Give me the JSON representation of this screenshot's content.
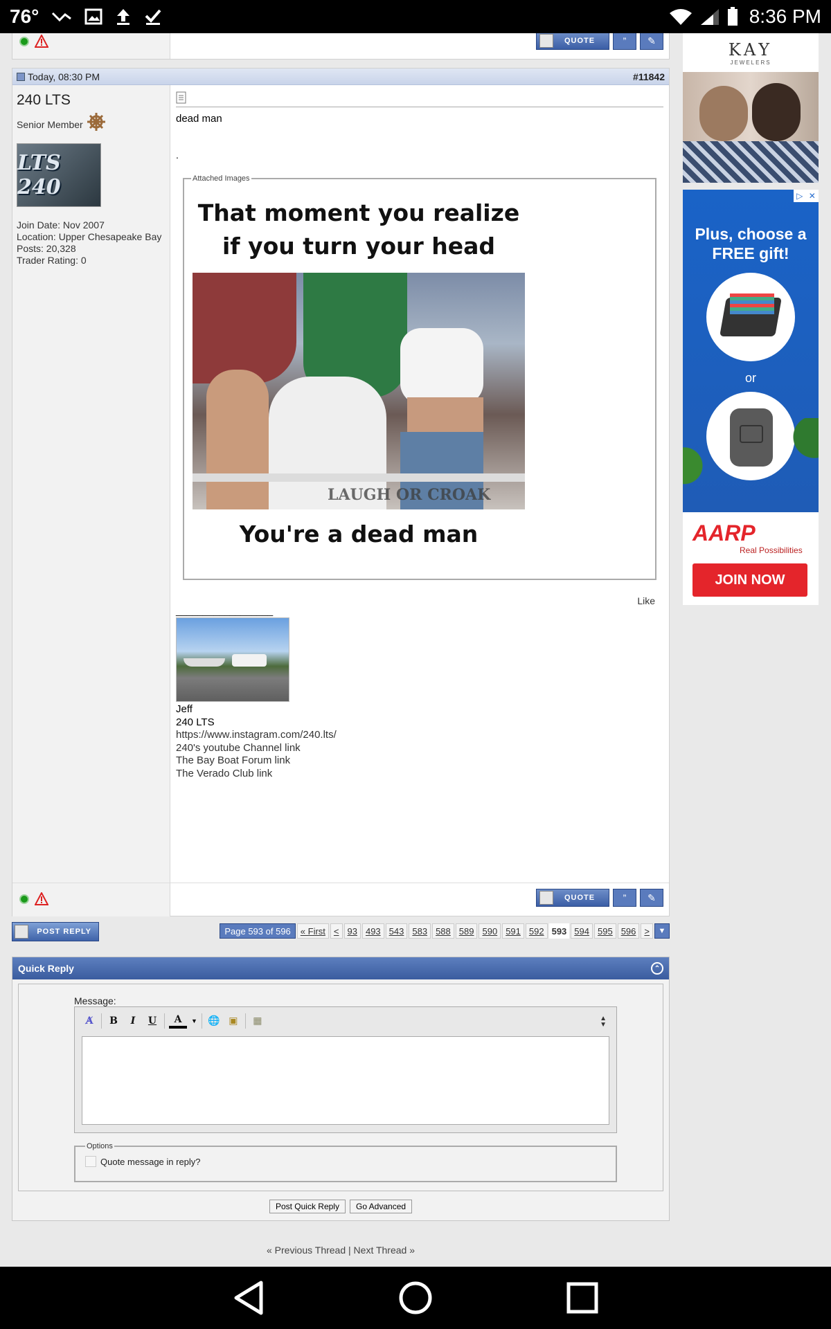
{
  "status_bar": {
    "temperature": "76°",
    "time": "8:36 PM"
  },
  "post": {
    "date": "Today, 08:30 PM",
    "post_number": "#11842",
    "username": "240 LTS",
    "user_title": "Senior Member",
    "avatar_text": "LTS 240",
    "join_date": "Join Date: Nov 2007",
    "location": "Location: Upper Chesapeake Bay",
    "posts": "Posts: 20,328",
    "trader_rating": "Trader Rating: 0",
    "message": "dead man",
    "dot": ".",
    "attachments_legend": "Attached Images",
    "meme_top": "That moment you realize if you turn your head",
    "meme_watermark": "LAUGH OR CROAK",
    "meme_bottom": "You're a dead man",
    "like_label": "Like",
    "sig_separator": "__________________",
    "signature": {
      "name": "Jeff",
      "boat": "240 LTS",
      "links": [
        "https://www.instagram.com/240.lts/",
        "240's youtube Channel link",
        "The Bay Boat Forum link",
        "The Verado Club link"
      ]
    }
  },
  "buttons": {
    "quote": "QUOTE",
    "post_reply": "POST REPLY"
  },
  "pagination": {
    "label": "Page 593 of 596",
    "first": "« First",
    "prev": "<",
    "pages": [
      "93",
      "493",
      "543",
      "583",
      "588",
      "589",
      "590",
      "591",
      "592",
      "593",
      "594",
      "595",
      "596"
    ],
    "current": "593",
    "next": ">"
  },
  "quick_reply": {
    "title": "Quick Reply",
    "message_label": "Message:",
    "options_legend": "Options",
    "quote_option": "Quote message in reply?",
    "post_button": "Post Quick Reply",
    "advanced_button": "Go Advanced"
  },
  "thread_nav": {
    "previous": "« Previous Thread",
    "separator": "|",
    "next": "Next Thread »"
  },
  "ads": {
    "kay_brand": "KAY",
    "kay_sub": "JEWELERS",
    "aarp_headline": "Plus, choose a FREE gift!",
    "aarp_or": "or",
    "aarp_brand": "AARP",
    "aarp_tagline": "Real Possibilities",
    "aarp_button": "JOIN NOW"
  },
  "colors": {
    "header_blue": "#3a5c9f",
    "aarp_red": "#e4252b",
    "ad_blue": "#1a63c7"
  }
}
